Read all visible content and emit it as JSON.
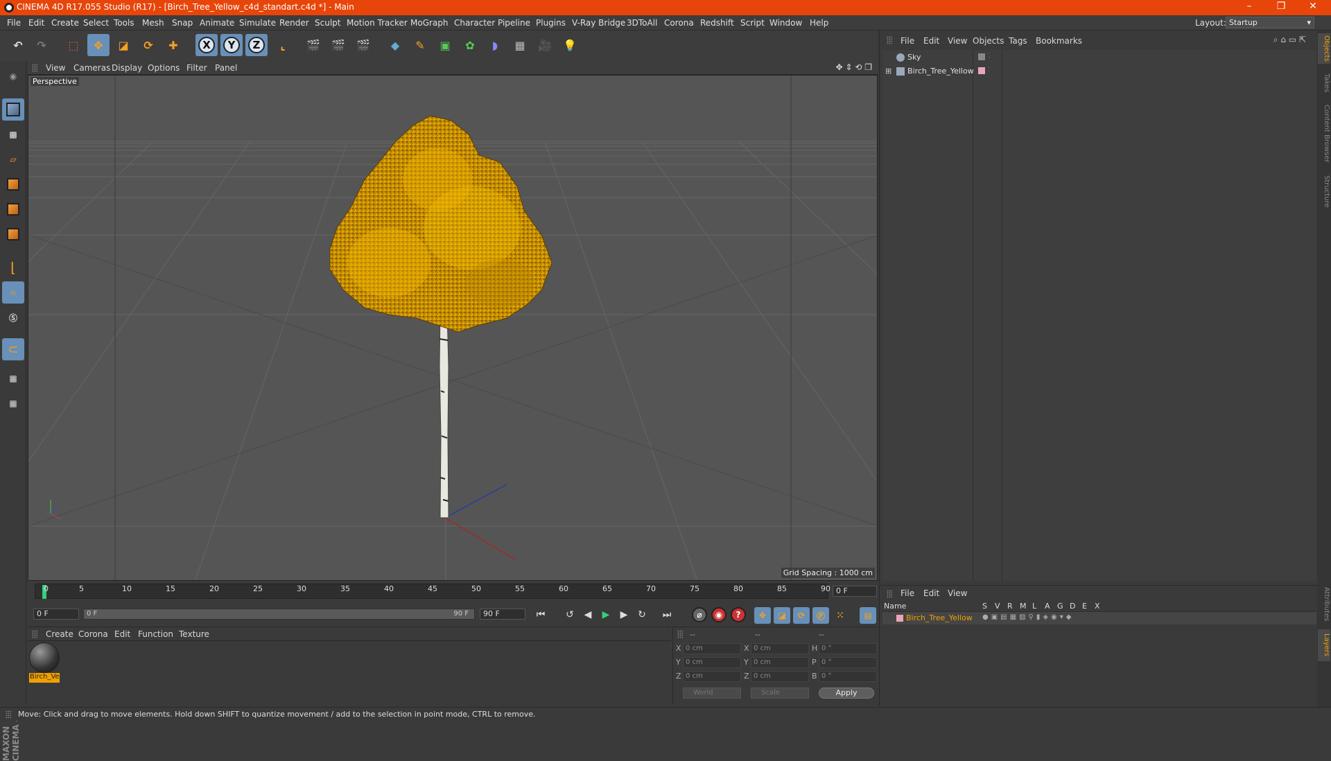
{
  "window": {
    "title": "CINEMA 4D R17.055 Studio (R17) - [Birch_Tree_Yellow_c4d_standart.c4d *] - Main"
  },
  "menubar": {
    "items": [
      "File",
      "Edit",
      "Create",
      "Select",
      "Tools",
      "Mesh",
      "Snap",
      "Animate",
      "Simulate",
      "Render",
      "Sculpt",
      "Motion Tracker",
      "MoGraph",
      "Character",
      "Pipeline",
      "Plugins",
      "V-Ray Bridge",
      "3DToAll",
      "Corona",
      "Redshift",
      "Script",
      "Window",
      "Help"
    ],
    "layout_label": "Layout:",
    "layout_value": "Startup"
  },
  "viewport": {
    "menu": [
      "View",
      "Cameras",
      "Display",
      "Options",
      "Filter",
      "Panel"
    ],
    "label": "Perspective",
    "grid_spacing": "Grid Spacing : 1000 cm"
  },
  "timeline": {
    "ticks": [
      "0",
      "5",
      "10",
      "15",
      "20",
      "25",
      "30",
      "35",
      "40",
      "45",
      "50",
      "55",
      "60",
      "65",
      "70",
      "75",
      "80",
      "85",
      "90"
    ],
    "current_frame": "0 F",
    "start": "0 F",
    "range_start": "0 F",
    "range_end": "90 F",
    "end": "90 F"
  },
  "materials": {
    "menu": [
      "Create",
      "Corona",
      "Edit",
      "Function",
      "Texture"
    ],
    "items": [
      {
        "name": "Birch_Ve"
      }
    ]
  },
  "coords": {
    "headers": [
      "--",
      "--",
      "--"
    ],
    "rows": [
      {
        "a": "X",
        "av": "0 cm",
        "b": "X",
        "bv": "0 cm",
        "c": "H",
        "cv": "0 °"
      },
      {
        "a": "Y",
        "av": "0 cm",
        "b": "Y",
        "bv": "0 cm",
        "c": "P",
        "cv": "0 °"
      },
      {
        "a": "Z",
        "av": "0 cm",
        "b": "Z",
        "bv": "0 cm",
        "c": "B",
        "cv": "0 °"
      }
    ],
    "mode1": "World",
    "mode2": "Scale",
    "apply": "Apply"
  },
  "objects_panel": {
    "menu": [
      "File",
      "Edit",
      "View",
      "Objects",
      "Tags",
      "Bookmarks"
    ],
    "objects": [
      {
        "name": "Sky"
      },
      {
        "name": "Birch_Tree_Yellow"
      }
    ]
  },
  "layers_panel": {
    "menu": [
      "File",
      "Edit",
      "View"
    ],
    "header": [
      "Name",
      "S",
      "V",
      "R",
      "M",
      "L",
      "A",
      "G",
      "D",
      "E",
      "X"
    ],
    "layers": [
      {
        "name": "Birch_Tree_Yellow",
        "color": "#f2a000"
      }
    ]
  },
  "side_tabs": [
    "Objects",
    "Takes",
    "Content Browser",
    "Structure",
    "Attributes",
    "Layers"
  ],
  "status": "Move: Click and drag to move elements. Hold down SHIFT to quantize movement / add to the selection in point mode, CTRL to remove.",
  "branding": {
    "logo": "MAXON CINEMA 4D"
  },
  "colors": {
    "title_bar": "#e8450a",
    "accent": "#f2a000",
    "active_tool": "#6890b8",
    "foliage": "#e8a800"
  }
}
